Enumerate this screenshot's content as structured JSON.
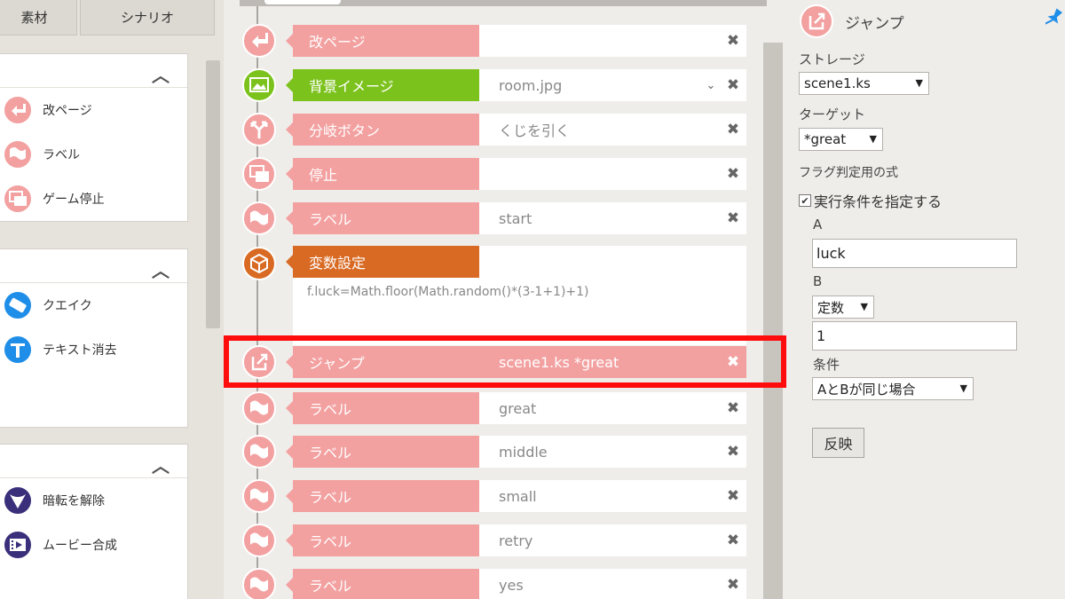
{
  "left_panel": {
    "tabs": [
      "素材",
      "シナリオ"
    ],
    "groups": [
      {
        "items": [
          {
            "label": "改ページ",
            "icon": "return-arrow-icon"
          },
          {
            "label": "ラベル",
            "icon": "flag-icon"
          },
          {
            "label": "ゲーム停止",
            "icon": "stop-windows-icon"
          }
        ]
      },
      {
        "items": [
          {
            "label": "クエイク",
            "icon": "quake-icon"
          },
          {
            "label": "テキスト消去",
            "icon": "text-erase-icon"
          }
        ]
      },
      {
        "items": [
          {
            "label": "暗転を解除",
            "icon": "fade-release-icon"
          },
          {
            "label": "ムービー合成",
            "icon": "movie-icon"
          }
        ]
      }
    ]
  },
  "timeline": {
    "rows": [
      {
        "label": "改ページ",
        "value": "",
        "color": "pink",
        "icon": "return-arrow-icon"
      },
      {
        "label": "背景イメージ",
        "value": "room.jpg",
        "color": "green",
        "icon": "image-icon",
        "chevron": true
      },
      {
        "label": "分岐ボタン",
        "value": "くじを引く",
        "color": "pink",
        "icon": "branch-icon"
      },
      {
        "label": "停止",
        "value": "",
        "color": "pink",
        "icon": "stop-windows-icon"
      },
      {
        "label": "ラベル",
        "value": "start",
        "color": "pink",
        "icon": "flag-icon"
      }
    ],
    "variable_row": {
      "label": "変数設定",
      "code": "f.luck=Math.floor(Math.random()*(3-1+1)+1)",
      "color": "orange"
    },
    "selected_row": {
      "label": "ジャンプ",
      "value": "scene1.ks *great",
      "color": "pink",
      "icon": "jump-icon"
    },
    "rows_after": [
      {
        "label": "ラベル",
        "value": "great"
      },
      {
        "label": "ラベル",
        "value": "middle"
      },
      {
        "label": "ラベル",
        "value": "small"
      },
      {
        "label": "ラベル",
        "value": "retry"
      },
      {
        "label": "ラベル",
        "value": "yes"
      }
    ],
    "delete_glyph": "✖",
    "chevron_glyph": "⌄"
  },
  "properties": {
    "title": "ジャンプ",
    "storage_label": "ストレージ",
    "storage_value": "scene1.ks",
    "target_label": "ターゲット",
    "target_value": "*great",
    "flag_label": "フラグ判定用の式",
    "condition_checkbox_label": "実行条件を指定する",
    "condition_checked": true,
    "a_label": "A",
    "a_value": "luck",
    "b_label": "B",
    "b_type_value": "定数",
    "b_value": "1",
    "cond_label": "条件",
    "cond_value": "AとBが同じ場合",
    "apply_label": "反映"
  },
  "colors": {
    "pink": "#f3a0a0",
    "green": "#7cc21d",
    "orange": "#d86a23",
    "highlight": "#ff0d0d",
    "accent": "#1f8ee8"
  }
}
